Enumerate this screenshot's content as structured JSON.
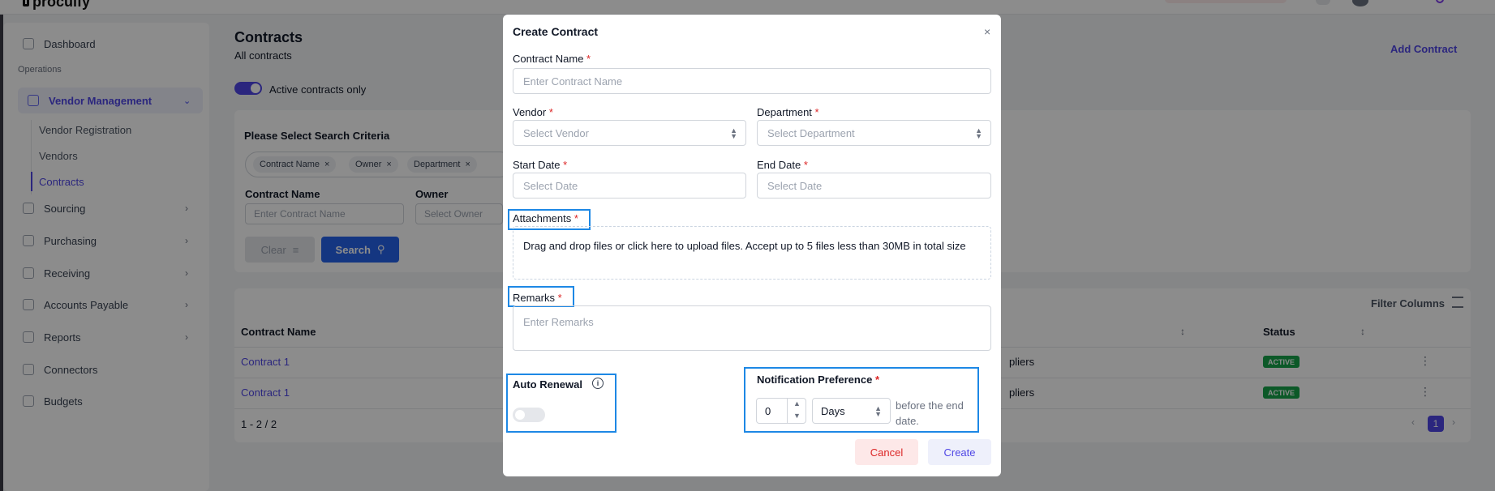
{
  "app": {
    "logo_text": "procuify"
  },
  "sidebar": {
    "dashboard": "Dashboard",
    "section_label": "Operations",
    "vendor_management": "Vendor Management",
    "vendor_sub": [
      "Vendor Registration",
      "Vendors",
      "Contracts"
    ],
    "items": [
      "Sourcing",
      "Purchasing",
      "Receiving",
      "Accounts Payable",
      "Reports",
      "Connectors",
      "Budgets"
    ]
  },
  "page": {
    "title": "Contracts",
    "subtitle": "All contracts",
    "add_button": "Add Contract",
    "active_toggle_label": "Active contracts only"
  },
  "criteria": {
    "title": "Please Select Search Criteria",
    "chips": [
      "Contract Name",
      "Owner",
      "Department"
    ],
    "contract_name_label": "Contract Name",
    "contract_name_placeholder": "Enter Contract Name",
    "owner_label": "Owner",
    "owner_placeholder": "Select Owner",
    "clear_label": "Clear",
    "search_label": "Search"
  },
  "table": {
    "filter_columns": "Filter Columns",
    "headers": {
      "contract_name": "Contract Name",
      "status": "Status"
    },
    "rows": [
      {
        "contract_name": "Contract 1",
        "vendor_fragment": "pliers",
        "status": "ACTIVE"
      },
      {
        "contract_name": "Contract 1",
        "vendor_fragment": "pliers",
        "status": "ACTIVE"
      }
    ],
    "pager_info": "1 - 2 / 2",
    "current_page": "1"
  },
  "modal": {
    "title": "Create Contract",
    "close_glyph": "×",
    "required_mark": "*",
    "contract_name": {
      "label": "Contract Name",
      "placeholder": "Enter Contract Name"
    },
    "vendor": {
      "label": "Vendor",
      "placeholder": "Select Vendor"
    },
    "department": {
      "label": "Department",
      "placeholder": "Select Department"
    },
    "start_date": {
      "label": "Start Date",
      "placeholder": "Select Date"
    },
    "end_date": {
      "label": "End Date",
      "placeholder": "Select Date"
    },
    "attachments": {
      "label": "Attachments",
      "dropzone_text": "Drag and drop files or click here to upload files. Accept up to 5 files less than 30MB in total size"
    },
    "remarks": {
      "label": "Remarks",
      "placeholder": "Enter Remarks"
    },
    "auto_renewal": {
      "label": "Auto Renewal",
      "enabled": false
    },
    "notification": {
      "label": "Notification Preference",
      "value": "0",
      "unit": "Days",
      "suffix": "before the end date."
    },
    "cancel_label": "Cancel",
    "create_label": "Create"
  },
  "colors": {
    "accent": "#4f46e5",
    "highlight_box": "#1d88e5",
    "status_active": "#16a34a",
    "danger": "#dc2626"
  }
}
